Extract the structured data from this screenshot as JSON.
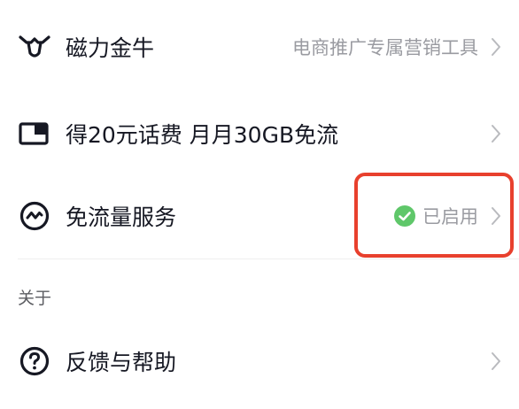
{
  "settings": {
    "items": [
      {
        "label": "磁力金牛",
        "right_text": "电商推广专属营销工具",
        "icon": "bull-head-icon"
      },
      {
        "label": "得20元话费 月月30GB免流",
        "right_text": "",
        "icon": "sim-card-icon"
      },
      {
        "label": "免流量服务",
        "status_text": "已启用",
        "icon": "wave-circle-icon",
        "status_icon": "check-circle-icon"
      }
    ],
    "about_section_title": "关于",
    "about_items": [
      {
        "label": "反馈与帮助",
        "icon": "question-circle-icon"
      }
    ]
  },
  "colors": {
    "text_primary": "#161823",
    "text_secondary": "#9a9ba1",
    "check_green": "#5fc76a",
    "highlight_red": "#e8402d"
  }
}
